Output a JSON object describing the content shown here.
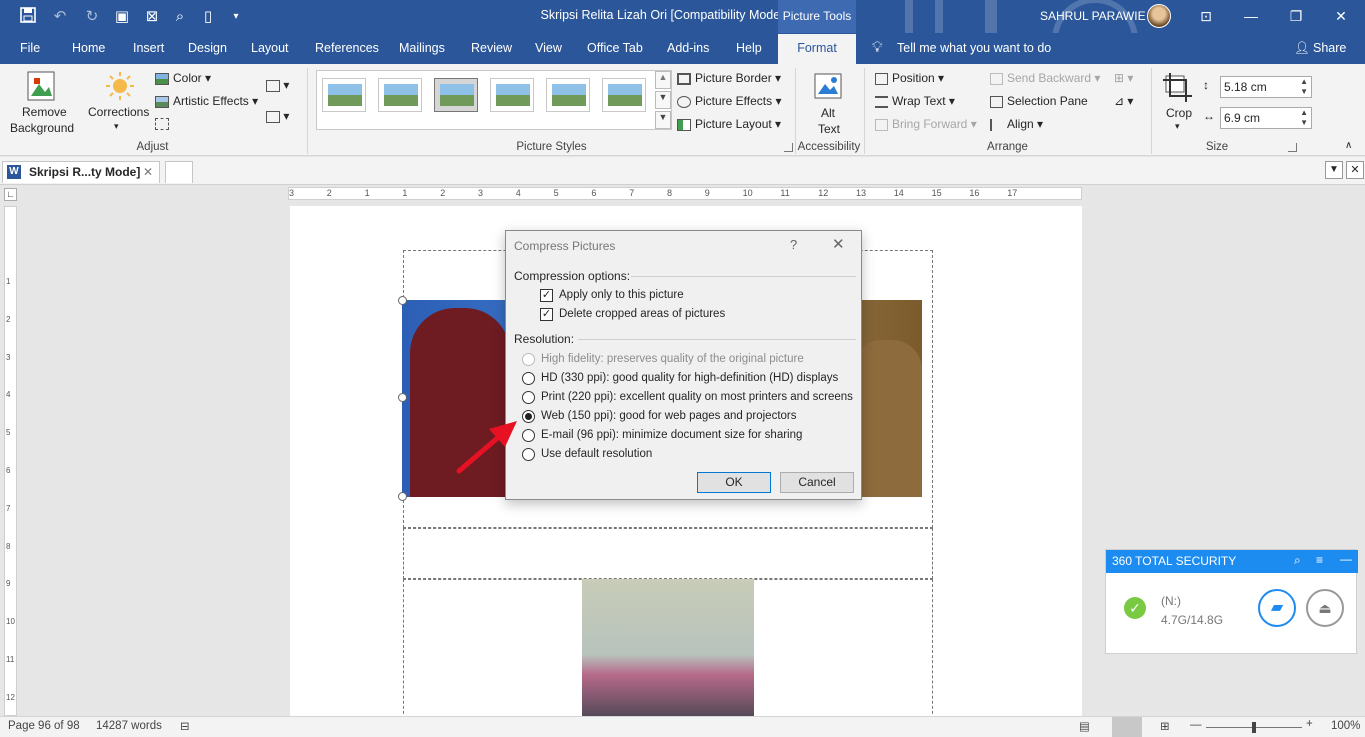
{
  "titlebar": {
    "title": "Skripsi Relita Lizah Ori [Compatibility Mode]  -  Word",
    "contextual_tab": "Picture Tools",
    "user": "SAHRUL PARAWIE"
  },
  "tabs": [
    "File",
    "Home",
    "Insert",
    "Design",
    "Layout",
    "References",
    "Mailings",
    "Review",
    "View",
    "Office Tab",
    "Add-ins",
    "Help",
    "Format"
  ],
  "tell_me": "Tell me what you want to do",
  "share": "Share",
  "ribbon": {
    "adjust": {
      "remove_bg_1": "Remove",
      "remove_bg_2": "Background",
      "corrections": "Corrections",
      "color": "Color",
      "artistic": "Artistic Effects",
      "label": "Adjust"
    },
    "styles": {
      "border": "Picture Border",
      "effects": "Picture Effects",
      "layout": "Picture Layout",
      "label": "Picture Styles"
    },
    "accessibility": {
      "alt1": "Alt",
      "alt2": "Text",
      "label": "Accessibility"
    },
    "arrange": {
      "position": "Position",
      "wrap": "Wrap Text",
      "bring_forward": "Bring Forward",
      "send_backward": "Send Backward",
      "selection_pane": "Selection Pane",
      "align": "Align",
      "label": "Arrange"
    },
    "size": {
      "crop": "Crop",
      "height": "5.18 cm",
      "width": "6.9 cm",
      "label": "Size"
    }
  },
  "doc_tab": "Skripsi R...ty Mode]",
  "ruler_numbers": [
    "3",
    "2",
    "1",
    "1",
    "2",
    "3",
    "4",
    "5",
    "6",
    "7",
    "8",
    "9",
    "10",
    "11",
    "12",
    "13",
    "14",
    "15",
    "16",
    "17"
  ],
  "vruler_numbers": [
    "1",
    "2",
    "3",
    "4",
    "5",
    "6",
    "7",
    "8",
    "9",
    "10",
    "11",
    "12"
  ],
  "dialog": {
    "title": "Compress Pictures",
    "help": "?",
    "close": "✕",
    "compression_label": "Compression options:",
    "apply_only": "Apply only to this picture",
    "delete_cropped": "Delete cropped areas of pictures",
    "resolution_label": "Resolution:",
    "options": [
      {
        "text": "High fidelity: preserves quality of the original picture",
        "disabled": true,
        "selected": false
      },
      {
        "text": "HD (330 ppi): good quality for high-definition (HD) displays",
        "disabled": false,
        "selected": false
      },
      {
        "text": "Print (220 ppi): excellent quality on most printers and screens",
        "disabled": false,
        "selected": false
      },
      {
        "text": "Web (150 ppi): good for web pages and projectors",
        "disabled": false,
        "selected": true
      },
      {
        "text": "E-mail (96 ppi): minimize document size for sharing",
        "disabled": false,
        "selected": false
      },
      {
        "text": "Use default resolution",
        "disabled": false,
        "selected": false
      }
    ],
    "ok": "OK",
    "cancel": "Cancel"
  },
  "security": {
    "title": "360 TOTAL SECURITY",
    "drive": "(N:)",
    "capacity": "4.7G/14.8G"
  },
  "status": {
    "page": "Page 96 of 98",
    "words": "14287 words",
    "zoom": "100%"
  }
}
